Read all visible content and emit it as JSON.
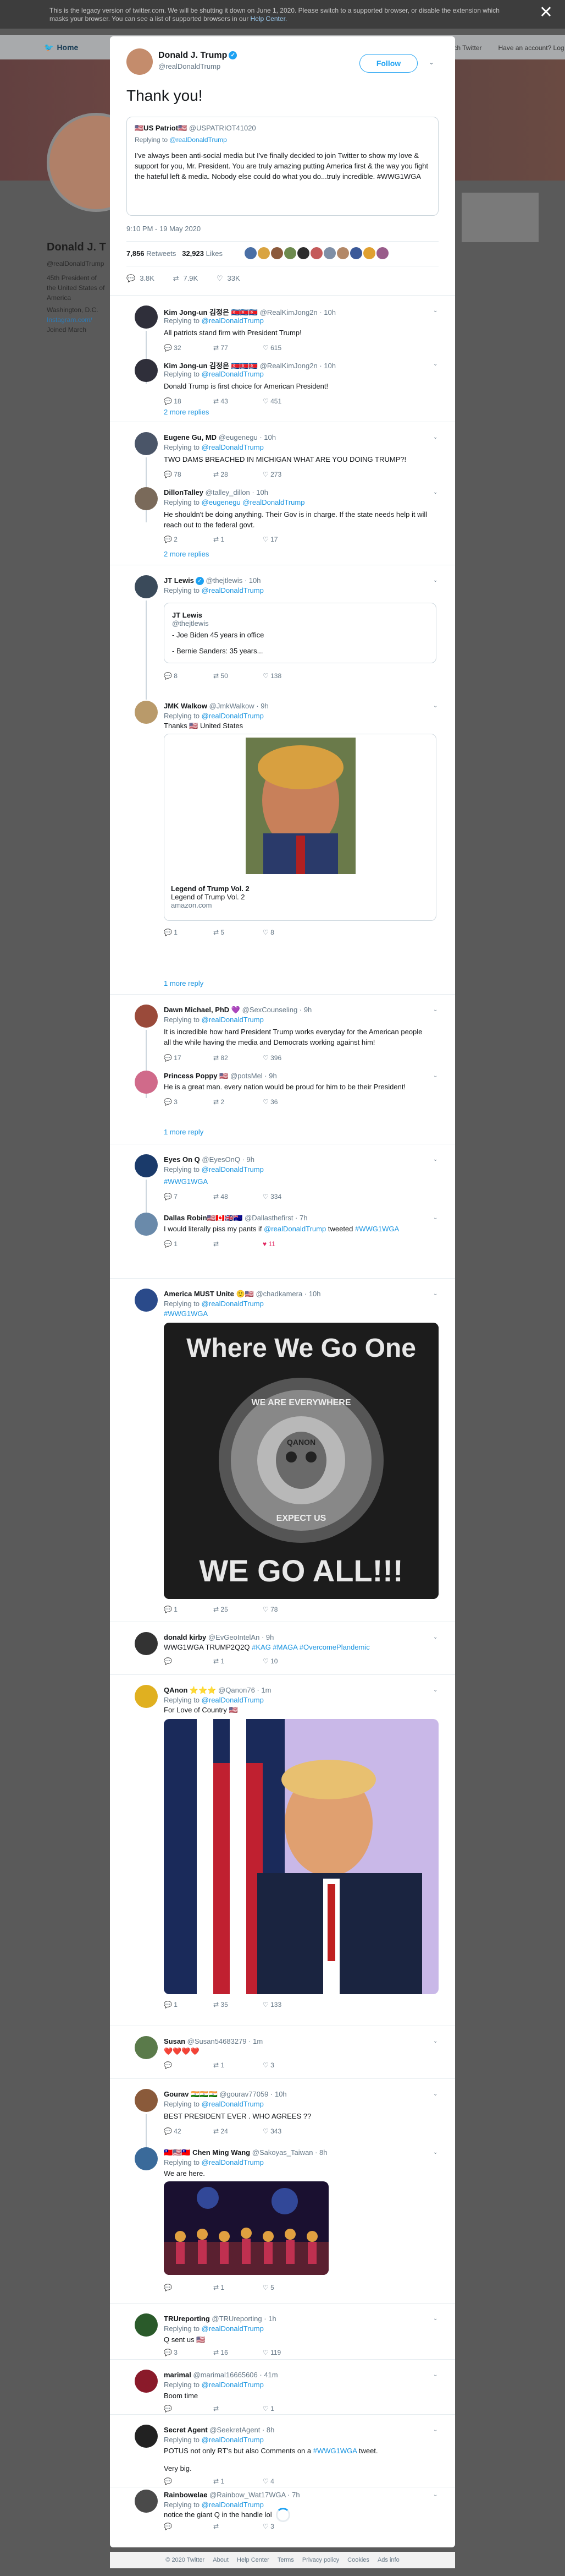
{
  "legacy_bar": {
    "text": "This is the legacy version of twitter.com. We will be shutting it down on June 1, 2020. Please switch to a supported browser, or disable the extension which masks your browser. You can see a list of supported browsers in our",
    "link": "Help Center."
  },
  "background": {
    "nav_home": "Home",
    "nav_search": "Search Twitter",
    "nav_lang": "Have an account? Log in ▾",
    "name": "Donald J. T",
    "handle": "@realDonaldTrump",
    "bio": "45th President of the United States of America",
    "location": "Washington, D.C.",
    "website": "Instagram.com/",
    "joined": "Joined March"
  },
  "main_tweet": {
    "name": "Donald J. Trump",
    "handle": "@realDonaldTrump",
    "follow_label": "Follow",
    "text": "Thank you!",
    "quoted": {
      "name": "🇺🇸US Patriot🇺🇸",
      "handle": "@USPATRIOT41020",
      "replying_prefix": "Replying to",
      "replying_to": "@realDonaldTrump",
      "text": "I've always been anti-social media but I've finally decided to join Twitter to show my love & support for you, Mr. President. You are truly amazing putting America first & the way you fight the hateful left & media. Nobody else could do what you do...truly incredible. #WWG1WGA"
    },
    "timestamp": "9:10 PM - 19 May 2020",
    "retweets": "7,856",
    "retweets_label": "Retweets",
    "likes": "32,923",
    "likes_label": "Likes",
    "reply_count": "3.8K",
    "retweet_count": "7.9K",
    "like_count": "33K"
  },
  "liker_colors": [
    "#4a6fa5",
    "#d9a441",
    "#8b5a3c",
    "#6d8a4e",
    "#2d2d2d",
    "#c45a5a",
    "#7f8fa6",
    "#b38867",
    "#3b5998",
    "#e0a030",
    "#995c8a"
  ],
  "replies": [
    {
      "name": "Kim Jong-un 김정은 🇰🇵🇰🇵🇰🇵",
      "handle": "@RealKimJong2n · 10h",
      "replying": "@realDonaldTrump",
      "body": "All patriots stand firm with President Trump!",
      "r": "32",
      "rt": "77",
      "lk": "615"
    },
    {
      "name": "Kim Jong-un 김정은 🇰🇵🇰🇵🇰🇵",
      "handle": "@RealKimJong2n · 10h",
      "replying": "@realDonaldTrump",
      "body": "Donald Trump is first choice for American President!",
      "r": "18",
      "rt": "43",
      "lk": "451"
    },
    {
      "name": "Eugene Gu, MD",
      "handle": "@eugenegu · 10h",
      "replying": "@realDonaldTrump",
      "body": "TWO DAMS BREACHED IN MICHIGAN WHAT ARE YOU DOING TRUMP?!",
      "r": "78",
      "rt": "28",
      "lk": "273"
    },
    {
      "name": "DillonTalley",
      "handle": "@talley_dillon · 10h",
      "replying": "@eugenegu @realDonaldTrump",
      "body": "He shouldn't be doing anything. Their Gov is in charge. If the state needs help it will reach out to the federal govt.",
      "r": "2",
      "rt": "1",
      "lk": "17"
    },
    {
      "name": "JT Lewis",
      "handle": "@thejtlewis · 10h",
      "replying": "@realDonaldTrump",
      "card_name": "JT Lewis",
      "card_handle": "@thejtlewis",
      "card_line1": "- Joe Biden 45 years in office",
      "card_line2": "- Bernie Sanders: 35 years...",
      "r": "8",
      "rt": "50",
      "lk": "138"
    },
    {
      "name": "JMK Walkow",
      "handle": "@JmkWalkow · 9h",
      "replying": "@realDonaldTrump",
      "body": "Thanks 🇺🇸 United States",
      "card_title": "Legend of Trump Vol. 2",
      "card_sub": "Legend of Trump Vol. 2",
      "card_dom": "amazon.com",
      "r": "1",
      "rt": "5",
      "lk": "8"
    },
    {
      "name": "Dawn Michael, PhD 💜",
      "handle": "@SexCounseling · 9h",
      "replying": "@realDonaldTrump",
      "body": "It is incredible how hard President Trump works everyday for the American people all the while having the media and Democrats working against him!",
      "r": "17",
      "rt": "82",
      "lk": "396"
    },
    {
      "name": "Princess Poppy 🇺🇸",
      "handle": "@potsMel · 9h",
      "replying": "@realDonaldTrump",
      "body": "He is a great man. every nation would be proud for him to be their President!",
      "r": "3",
      "rt": "2",
      "lk": "36"
    },
    {
      "name": "Eyes On Q",
      "handle": "@EyesOnQ · 9h",
      "replying": "@realDonaldTrump",
      "body": "#WWG1WGA",
      "r": "7",
      "rt": "48",
      "lk": "334"
    },
    {
      "name": "Dallas Robin🇺🇸🇨🇦🇬🇧🇦🇺",
      "handle": "@Dallasthefirst · 7h",
      "body_pre": "I would literally piss my pants if",
      "body_tag1": "@realDonaldTrump",
      "body_mid": "tweeted",
      "body_tag2": "#WWG1WGA",
      "r": "1",
      "rt": "",
      "lk": "11"
    },
    {
      "name": "America MUST Unite 🙂🇺🇸",
      "handle": "@chadkamera · 10h",
      "replying": "@realDonaldTrump",
      "body": "#WWG1WGA",
      "img_top": "Where We Go One",
      "img_bottom": "WE GO ALL!!!",
      "coin_top": "WE ARE EVERYWHERE",
      "coin_bottom": "EXPECT US",
      "coin_center": "QANON",
      "r": "1",
      "rt": "25",
      "lk": "78"
    },
    {
      "name": "donald kirby",
      "handle": "@EvGeoIntelAn · 9h",
      "body": "WWG1WGA TRUMP2Q2Q",
      "tags": "#KAG #MAGA #OvercomePlandemic",
      "r": "",
      "rt": "1",
      "lk": "10"
    },
    {
      "name": "QAnon ⭐⭐⭐",
      "handle": "@Qanon76 · 1m",
      "replying": "@realDonaldTrump",
      "body": "For Love of Country 🇺🇸",
      "r": "1",
      "rt": "35",
      "lk": "133"
    },
    {
      "name": "Susan",
      "handle": "@Susan54683279 · 1m",
      "body": "❤️❤️❤️❤️",
      "r": "",
      "rt": "1",
      "lk": "3"
    },
    {
      "name": "Gourav 🇮🇳🇮🇳🇮🇳",
      "handle": "@gourav77059 · 10h",
      "replying": "@realDonaldTrump",
      "body": "BEST PRESIDENT EVER . WHO AGREES ??",
      "r": "42",
      "rt": "24",
      "lk": "343"
    },
    {
      "name": "🇹🇼🇺🇸🇹🇼 Chen Ming Wang",
      "handle": "@Sakoyas_Taiwan · 8h",
      "replying": "@realDonaldTrump",
      "body": "We are here.",
      "r": "",
      "rt": "1",
      "lk": "5"
    },
    {
      "name": "TRUreporting",
      "handle": "@TRUreporting · 1h",
      "replying": "@realDonaldTrump",
      "body": "Q sent us 🇺🇸",
      "r": "3",
      "rt": "16",
      "lk": "119"
    },
    {
      "name": "marimal",
      "handle": "@marimal16665606 · 41m",
      "replying": "@realDonaldTrump",
      "body": "Boom time",
      "r": "",
      "rt": "",
      "lk": "1"
    },
    {
      "name": "Secret Agent",
      "handle": "@SeekretAgent · 8h",
      "replying": "@realDonaldTrump",
      "body_pre": "POTUS not only RT's but also Comments on a",
      "body_tag": "#WWG1WGA",
      "body_post": "tweet.",
      "body2": "Very big.",
      "r": "",
      "rt": "1",
      "lk": "4"
    },
    {
      "name": "Rainbowelae",
      "handle": "@Rainbow_Wat17WGA · 7h",
      "replying": "@realDonaldTrump",
      "body": "notice the giant Q in the handle lol",
      "r": "",
      "rt": "",
      "lk": "3"
    }
  ],
  "show_replies_label": "2 more replies",
  "one_more_reply_label": "1 more reply",
  "replying_prefix": "Replying to",
  "footer": [
    "© 2020 Twitter",
    "About",
    "Help Center",
    "Terms",
    "Privacy policy",
    "Cookies",
    "Ads info"
  ],
  "colors": {
    "accent": "#1da1f2",
    "retweet": "#17bf63",
    "like": "#e0245e"
  }
}
